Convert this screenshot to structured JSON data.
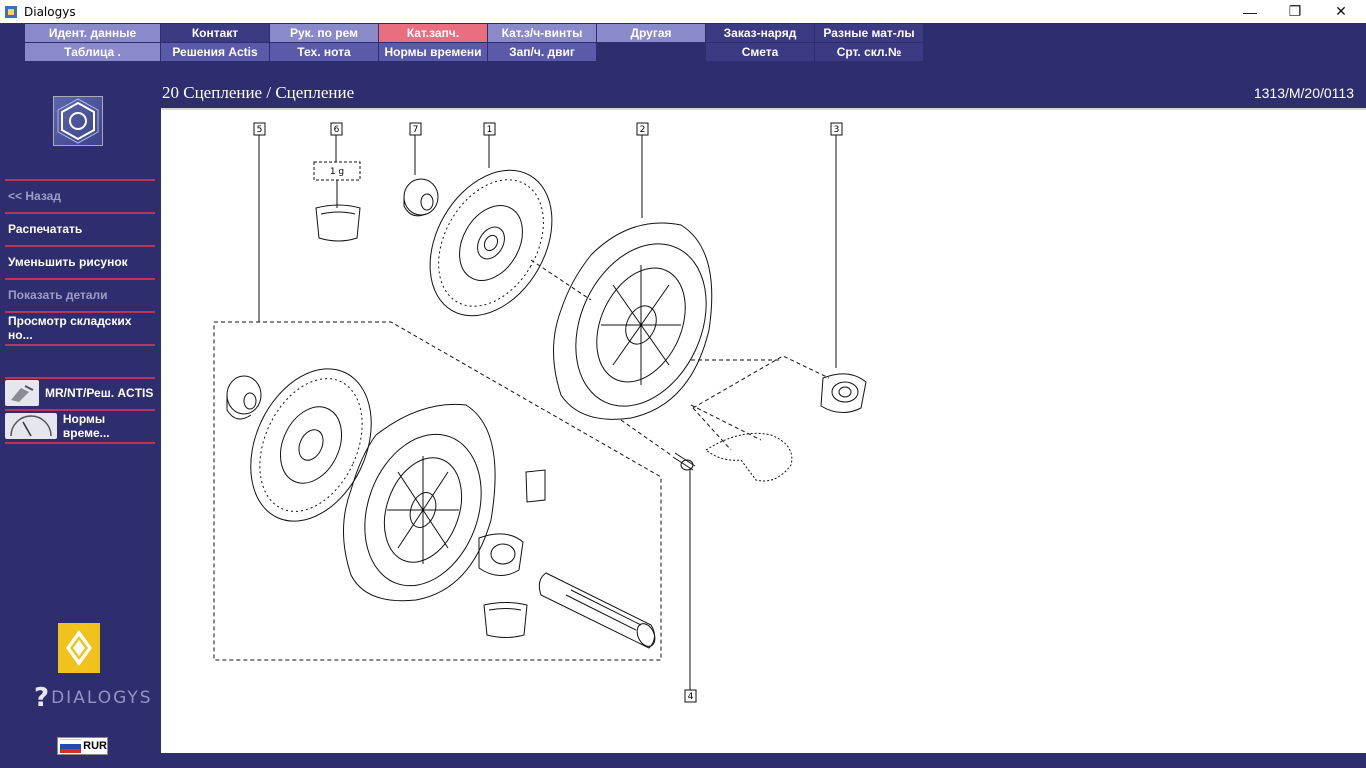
{
  "window": {
    "title": "Dialogys",
    "minimize_glyph": "—",
    "maximize_glyph": "❐",
    "close_glyph": "✕"
  },
  "tabs": {
    "row1": [
      "Идент. данные",
      "Контакт",
      "Рук. по рем",
      "Кат.запч.",
      "Кат.з/ч-винты",
      "Другая",
      "Заказ-наряд",
      "Разные мат-лы"
    ],
    "row2": [
      "Таблица .",
      "Решения Actis",
      "Тех. нота",
      "Нормы времени",
      "Зап/ч. двиг",
      "Смета",
      "Срт. скл.№"
    ],
    "active": "Кат.запч."
  },
  "sidebar": {
    "items": [
      {
        "label": "<< Назад",
        "enabled": false
      },
      {
        "label": "Распечатать",
        "enabled": true
      },
      {
        "label": "Уменьшить рисунок",
        "enabled": true
      },
      {
        "label": "Показать детали",
        "enabled": false
      },
      {
        "label": "Просмотр складских но...",
        "enabled": true
      }
    ],
    "tools": [
      {
        "label": "MR/NT/Реш. ACTIS",
        "icon": "manual-icon"
      },
      {
        "label": "Нормы време...",
        "icon": "gauge-icon"
      }
    ],
    "brand": "DIALOGYS",
    "brand_mark": "?",
    "currency": "RUR"
  },
  "header": {
    "title": "20 Сцепление / Сцепление",
    "reference": "1313/M/20/0113"
  },
  "diagram": {
    "callouts": [
      "5",
      "6",
      "7",
      "1",
      "2",
      "3",
      "4"
    ],
    "quantity_label": "1 g"
  },
  "colors": {
    "background": "#2e2d6e",
    "tab_light": "#8a89c9",
    "tab_dark": "#3b3a82",
    "tab_active": "#e96f80",
    "separator": "#b9365a",
    "brand_yellow": "#f1c21b"
  }
}
